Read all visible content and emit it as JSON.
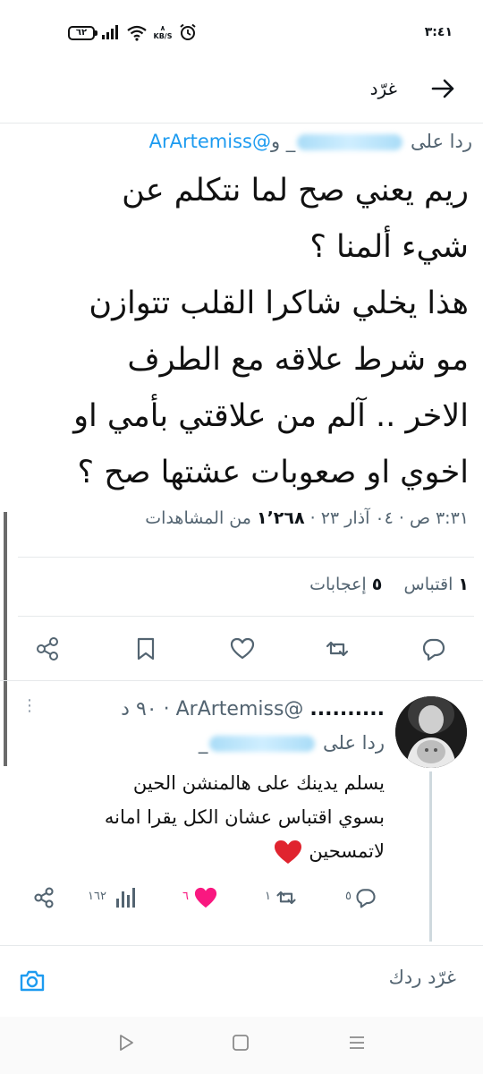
{
  "status_bar": {
    "battery": "٦٢",
    "netspeed_top": "٨",
    "netspeed_bottom": "KB/S",
    "time": "٣:٤١"
  },
  "header": {
    "title": "غرّد"
  },
  "tweet": {
    "reply_prefix": "ردا على",
    "reply_and": "و",
    "reply_mention": "@ArArtemiss",
    "text_lines": [
      "ريم يعني صح لما نتكلم عن",
      "شيء ألمنا ؟",
      "هذا يخلي شاكرا القلب تتوازن",
      "مو شرط علاقه مع الطرف",
      "الاخر .. آلم من علاقتي بأمي او",
      "اخوي او صعوبات عشتها صح ؟"
    ],
    "time": "٣:٣١ ص",
    "date": "٠٤ آذار ٢٣",
    "views_count": "١٬٢٦٨",
    "views_label": "من المشاهدات",
    "quotes_count": "١",
    "quotes_label": "اقتباس",
    "likes_count": "٥",
    "likes_label": "إعجابات"
  },
  "reply": {
    "name": "..........",
    "handle": "@ArArtemiss",
    "age": "٩٠ د",
    "reply_prefix": "ردا على",
    "text_lines": [
      "يسلم يدينك على هالمنشن الحين",
      "بسوي اقتباس عشان الكل يقرا امانه",
      "لاتمسحين"
    ],
    "replies_count": "٥",
    "retweets_count": "١",
    "likes_count": "٦",
    "views_count": "١٦٢"
  },
  "compose": {
    "placeholder": "غرّد ردك"
  },
  "colors": {
    "accent": "#1d9bf0",
    "like": "#f91880",
    "heart_emoji": "#e0242f"
  }
}
